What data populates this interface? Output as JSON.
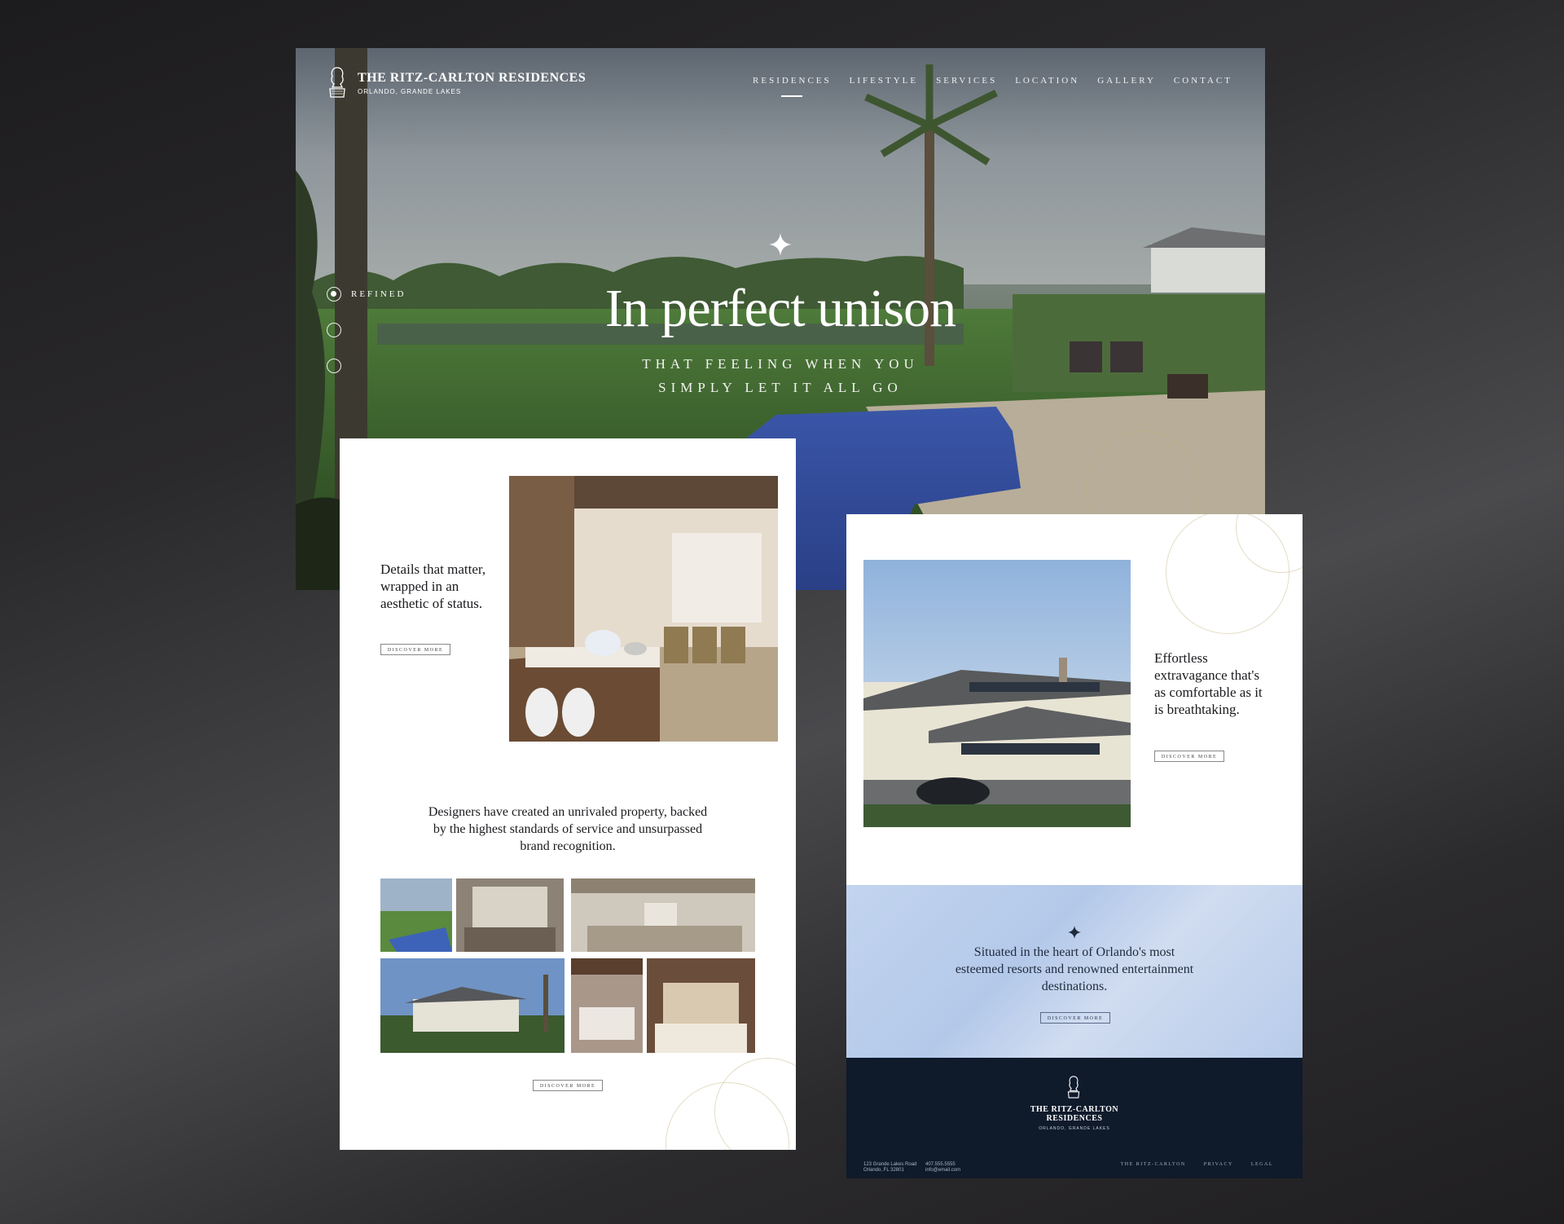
{
  "hero": {
    "brand_name": "THE RITZ-CARLTON RESIDENCES",
    "brand_sub": "ORLANDO, GRANDE LAKES",
    "nav": [
      "RESIDENCES",
      "LIFESTYLE",
      "SERVICES",
      "LOCATION",
      "GALLERY",
      "CONTACT"
    ],
    "active_nav": "RESIDENCES",
    "title": "In perfect unison",
    "subtitle_line1": "THAT FEELING WHEN YOU",
    "subtitle_line2": "SIMPLY LET IT ALL GO",
    "slides": [
      {
        "label": "REFINED",
        "active": true
      },
      {
        "label": "",
        "active": false
      },
      {
        "label": "",
        "active": false
      }
    ]
  },
  "left_page": {
    "details_text": "Details that matter, wrapped in an aesthetic of status.",
    "discover_1": "DISCOVER MORE",
    "designers_text": "Designers have created an unrivaled property, backed by the highest standards of service and unsurpassed brand recognition.",
    "discover_2": "DISCOVER MORE"
  },
  "right_page": {
    "effortless_text": "Effortless extravagance that's as comfortable as it is breathtaking.",
    "discover_1": "DISCOVER MORE",
    "situated_text": "Situated in the heart of Orlando's most esteemed resorts and renowned entertainment destinations.",
    "discover_2": "DISCOVER MORE",
    "footer": {
      "name_line1": "THE RITZ-CARLTON",
      "name_line2": "RESIDENCES",
      "sub": "ORLANDO, GRANDE LAKES",
      "address_line1": "123 Grande Lakes Road",
      "address_line2": "Orlando, FL 32801",
      "phone": "407.555.5555",
      "email": "info@email.com",
      "links": [
        "THE RITZ-CARLTON",
        "PRIVACY",
        "LEGAL"
      ]
    }
  },
  "colors": {
    "navy": "#0f1a2b",
    "band_blue": "#b4c9ea",
    "gold_line": "#c4b280"
  }
}
